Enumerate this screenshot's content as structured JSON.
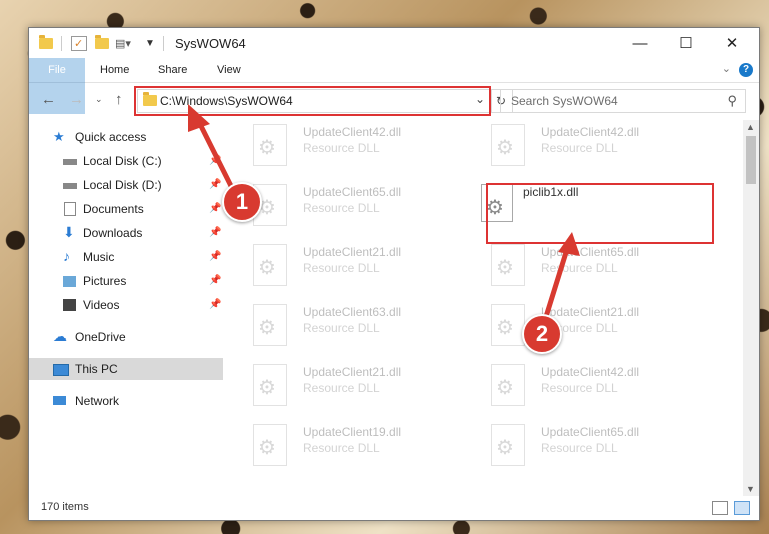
{
  "window": {
    "title": "SysWOW64",
    "controls": {
      "minimize": "—",
      "maximize": "☐",
      "close": "✕"
    }
  },
  "ribbon": {
    "tabs": [
      "File",
      "Home",
      "Share",
      "View"
    ],
    "help": "?"
  },
  "address": {
    "path": "C:\\Windows\\SysWOW64",
    "search_placeholder": "Search SysWOW64"
  },
  "nav": {
    "items": [
      {
        "label": "Quick access",
        "icon": "star-icon"
      },
      {
        "label": "Local Disk (C:)",
        "icon": "drive-icon",
        "pinned": true
      },
      {
        "label": "Local Disk (D:)",
        "icon": "drive-icon",
        "pinned": true
      },
      {
        "label": "Documents",
        "icon": "documents-icon",
        "pinned": true
      },
      {
        "label": "Downloads",
        "icon": "download-icon",
        "pinned": true
      },
      {
        "label": "Music",
        "icon": "music-icon",
        "pinned": true
      },
      {
        "label": "Pictures",
        "icon": "pictures-icon",
        "pinned": true
      },
      {
        "label": "Videos",
        "icon": "videos-icon",
        "pinned": true
      },
      {
        "label": "OneDrive",
        "icon": "cloud-icon"
      },
      {
        "label": "This PC",
        "icon": "computer-icon",
        "selected": true
      },
      {
        "label": "Network",
        "icon": "network-icon"
      }
    ]
  },
  "files": [
    {
      "name": "UpdateClient42.dll",
      "type": "Resource DLL"
    },
    {
      "name": "UpdateClient42.dll",
      "type": "Resource DLL"
    },
    {
      "name": "UpdateClient65.dll",
      "type": "Resource DLL"
    },
    {
      "name": "piclib1x.dll",
      "type": "",
      "highlighted": true
    },
    {
      "name": "UpdateClient21.dll",
      "type": "Resource DLL"
    },
    {
      "name": "UpdateClient65.dll",
      "type": "Resource DLL"
    },
    {
      "name": "UpdateClient63.dll",
      "type": "Resource DLL"
    },
    {
      "name": "UpdateClient21.dll",
      "type": "Resource DLL"
    },
    {
      "name": "UpdateClient21.dll",
      "type": "Resource DLL"
    },
    {
      "name": "UpdateClient42.dll",
      "type": "Resource DLL"
    },
    {
      "name": "UpdateClient19.dll",
      "type": "Resource DLL"
    },
    {
      "name": "UpdateClient65.dll",
      "type": "Resource DLL"
    }
  ],
  "status": {
    "count": "170 items"
  },
  "annotations": {
    "step1": "1",
    "step2": "2"
  },
  "colors": {
    "accent": "#1979ca",
    "highlight_red": "#d83a30"
  }
}
